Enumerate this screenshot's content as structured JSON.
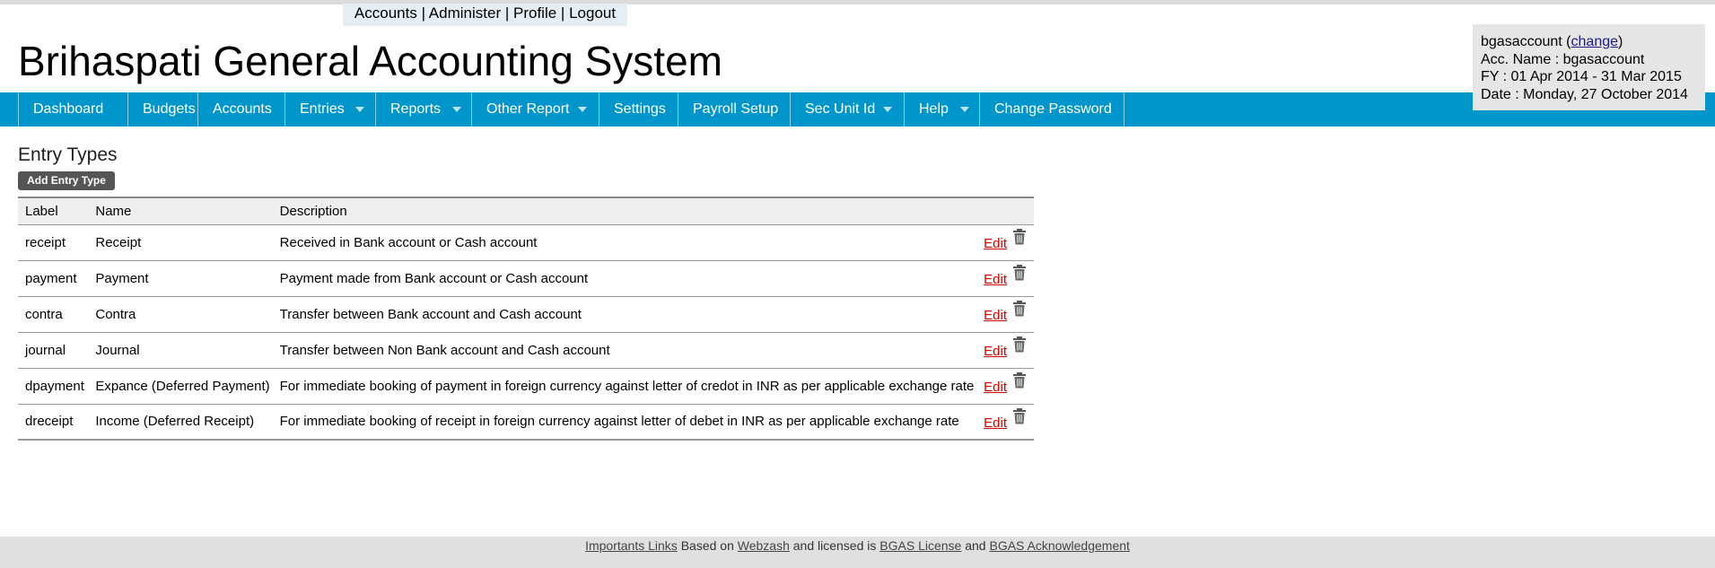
{
  "toplinks": {
    "accounts": "Accounts",
    "administer": "Administer",
    "profile": "Profile",
    "logout": "Logout",
    "separator": "|"
  },
  "app_title": "Brihaspati General Accounting System",
  "account_box": {
    "username": "bgasaccount",
    "change_label": "change",
    "acc_name": "Acc. Name : bgasaccount",
    "fy": "FY : 01 Apr 2014 - 31 Mar 2015",
    "date": "Date : Monday, 27 October 2014"
  },
  "nav": {
    "items": [
      {
        "label": "Dashboard",
        "dropdown": false
      },
      {
        "label": "Budgets",
        "dropdown": false
      },
      {
        "label": "Accounts",
        "dropdown": false
      },
      {
        "label": "Entries",
        "dropdown": true
      },
      {
        "label": "Reports",
        "dropdown": true
      },
      {
        "label": "Other Report",
        "dropdown": true
      },
      {
        "label": "Settings",
        "dropdown": false
      },
      {
        "label": "Payroll Setup",
        "dropdown": false
      },
      {
        "label": "Sec Unit Id",
        "dropdown": true
      },
      {
        "label": "Help",
        "dropdown": true
      },
      {
        "label": "Change Password",
        "dropdown": false
      }
    ]
  },
  "page_title": "Entry Types",
  "add_button": "Add Entry Type",
  "table": {
    "headers": {
      "label": "Label",
      "name": "Name",
      "description": "Description"
    },
    "edit_label": "Edit",
    "rows": [
      {
        "label": "receipt",
        "name": "Receipt",
        "description": "Received in Bank account or Cash account"
      },
      {
        "label": "payment",
        "name": "Payment",
        "description": "Payment made from Bank account or Cash account"
      },
      {
        "label": "contra",
        "name": "Contra",
        "description": "Transfer between Bank account and Cash account"
      },
      {
        "label": "journal",
        "name": "Journal",
        "description": "Transfer between Non Bank account and Cash account"
      },
      {
        "label": "dpayment",
        "name": "Expance (Deferred Payment)",
        "description": "For immediate booking of payment in foreign currency against letter of credot in INR as per applicable exchange rate"
      },
      {
        "label": "dreceipt",
        "name": "Income (Deferred Receipt)",
        "description": "For immediate booking of receipt in foreign currency against letter of debet in INR as per applicable exchange rate"
      }
    ]
  },
  "footer": {
    "important_links": "Importants Links",
    "based_on": "Based on",
    "webzash": "Webzash",
    "licensed": "and licensed is",
    "license": "BGAS License",
    "and": "and",
    "acknowledgement": "BGAS Acknowledgement"
  },
  "colors": {
    "nav_bg": "#0096cb",
    "edit_link": "#d40000",
    "button_bg": "#555555"
  }
}
